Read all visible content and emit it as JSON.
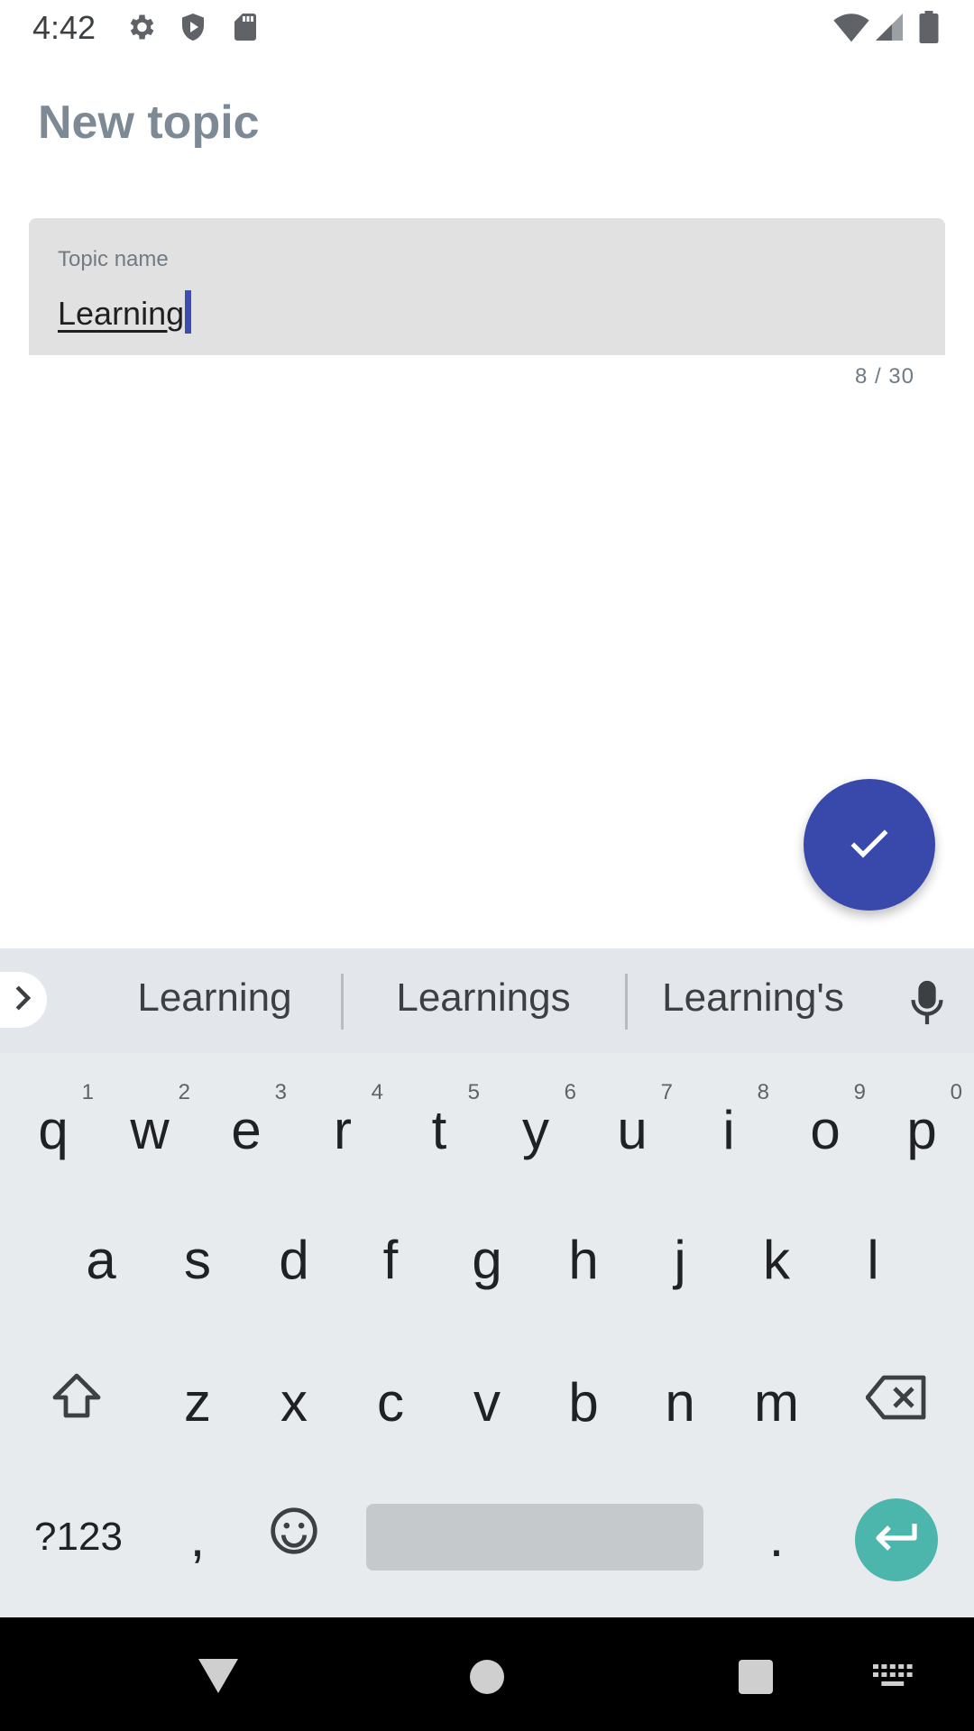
{
  "status_bar": {
    "time": "4:42",
    "left_icons": [
      "gear-icon",
      "shield-play-icon",
      "sd-card-icon"
    ],
    "right_icons": [
      "wifi-icon",
      "signal-icon",
      "battery-icon"
    ]
  },
  "page": {
    "title": "New topic"
  },
  "text_field": {
    "label": "Topic name",
    "value": "Learning",
    "counter": "8 / 30"
  },
  "fab": {
    "icon": "check-icon",
    "color": "#3949ab"
  },
  "keyboard": {
    "suggestions": [
      "Learning",
      "Learnings",
      "Learning's"
    ],
    "row1": [
      {
        "key": "q",
        "hint": "1"
      },
      {
        "key": "w",
        "hint": "2"
      },
      {
        "key": "e",
        "hint": "3"
      },
      {
        "key": "r",
        "hint": "4"
      },
      {
        "key": "t",
        "hint": "5"
      },
      {
        "key": "y",
        "hint": "6"
      },
      {
        "key": "u",
        "hint": "7"
      },
      {
        "key": "i",
        "hint": "8"
      },
      {
        "key": "o",
        "hint": "9"
      },
      {
        "key": "p",
        "hint": "0"
      }
    ],
    "row2": [
      "a",
      "s",
      "d",
      "f",
      "g",
      "h",
      "j",
      "k",
      "l"
    ],
    "row3": [
      "z",
      "x",
      "c",
      "v",
      "b",
      "n",
      "m"
    ],
    "symbols_label": "?123",
    "comma": ",",
    "period": ".",
    "enter_color": "#4db6ac"
  }
}
